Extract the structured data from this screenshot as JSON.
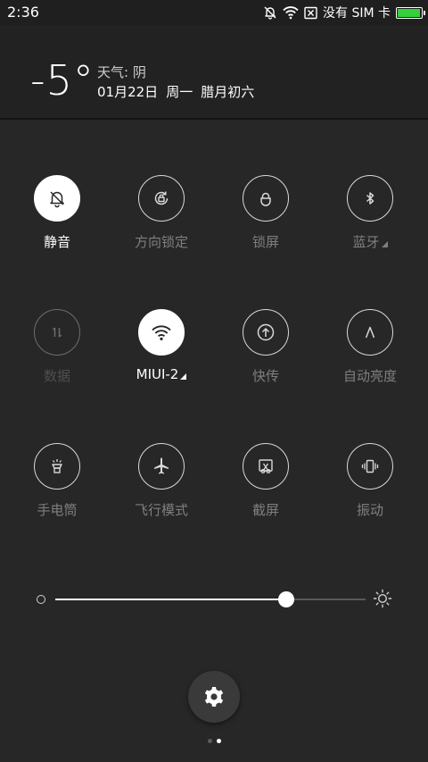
{
  "status_bar": {
    "time": "2:36",
    "carrier": "没有 SIM 卡",
    "icons": [
      "mute-bell-icon",
      "wifi-icon",
      "no-sim-icon",
      "battery-icon"
    ],
    "battery_level": 0.95,
    "battery_color": "#34d23a"
  },
  "header": {
    "temperature": "-5°",
    "weather": "天气: 阴",
    "date": "01月22日",
    "weekday": "周一",
    "lunar": "腊月初六"
  },
  "toggles": [
    {
      "label": "静音",
      "icon": "mute-bell-icon",
      "state": "on"
    },
    {
      "label": "方向锁定",
      "icon": "rotation-lock-icon",
      "state": "off"
    },
    {
      "label": "锁屏",
      "icon": "lock-icon",
      "state": "off"
    },
    {
      "label": "蓝牙",
      "icon": "bluetooth-icon",
      "state": "off",
      "more": true
    },
    {
      "label": "数据",
      "icon": "mobile-data-icon",
      "state": "disabled"
    },
    {
      "label": "MIUI-2",
      "icon": "wifi-icon",
      "state": "on",
      "more": true
    },
    {
      "label": "快传",
      "icon": "quick-transfer-icon",
      "state": "off"
    },
    {
      "label": "自动亮度",
      "icon": "auto-brightness-icon",
      "state": "off"
    },
    {
      "label": "手电筒",
      "icon": "flashlight-icon",
      "state": "off"
    },
    {
      "label": "飞行模式",
      "icon": "airplane-icon",
      "state": "off"
    },
    {
      "label": "截屏",
      "icon": "screenshot-icon",
      "state": "off"
    },
    {
      "label": "振动",
      "icon": "vibrate-icon",
      "state": "off"
    }
  ],
  "brightness": {
    "level": 0.745
  },
  "pager": {
    "pages": 2,
    "current": 1
  }
}
